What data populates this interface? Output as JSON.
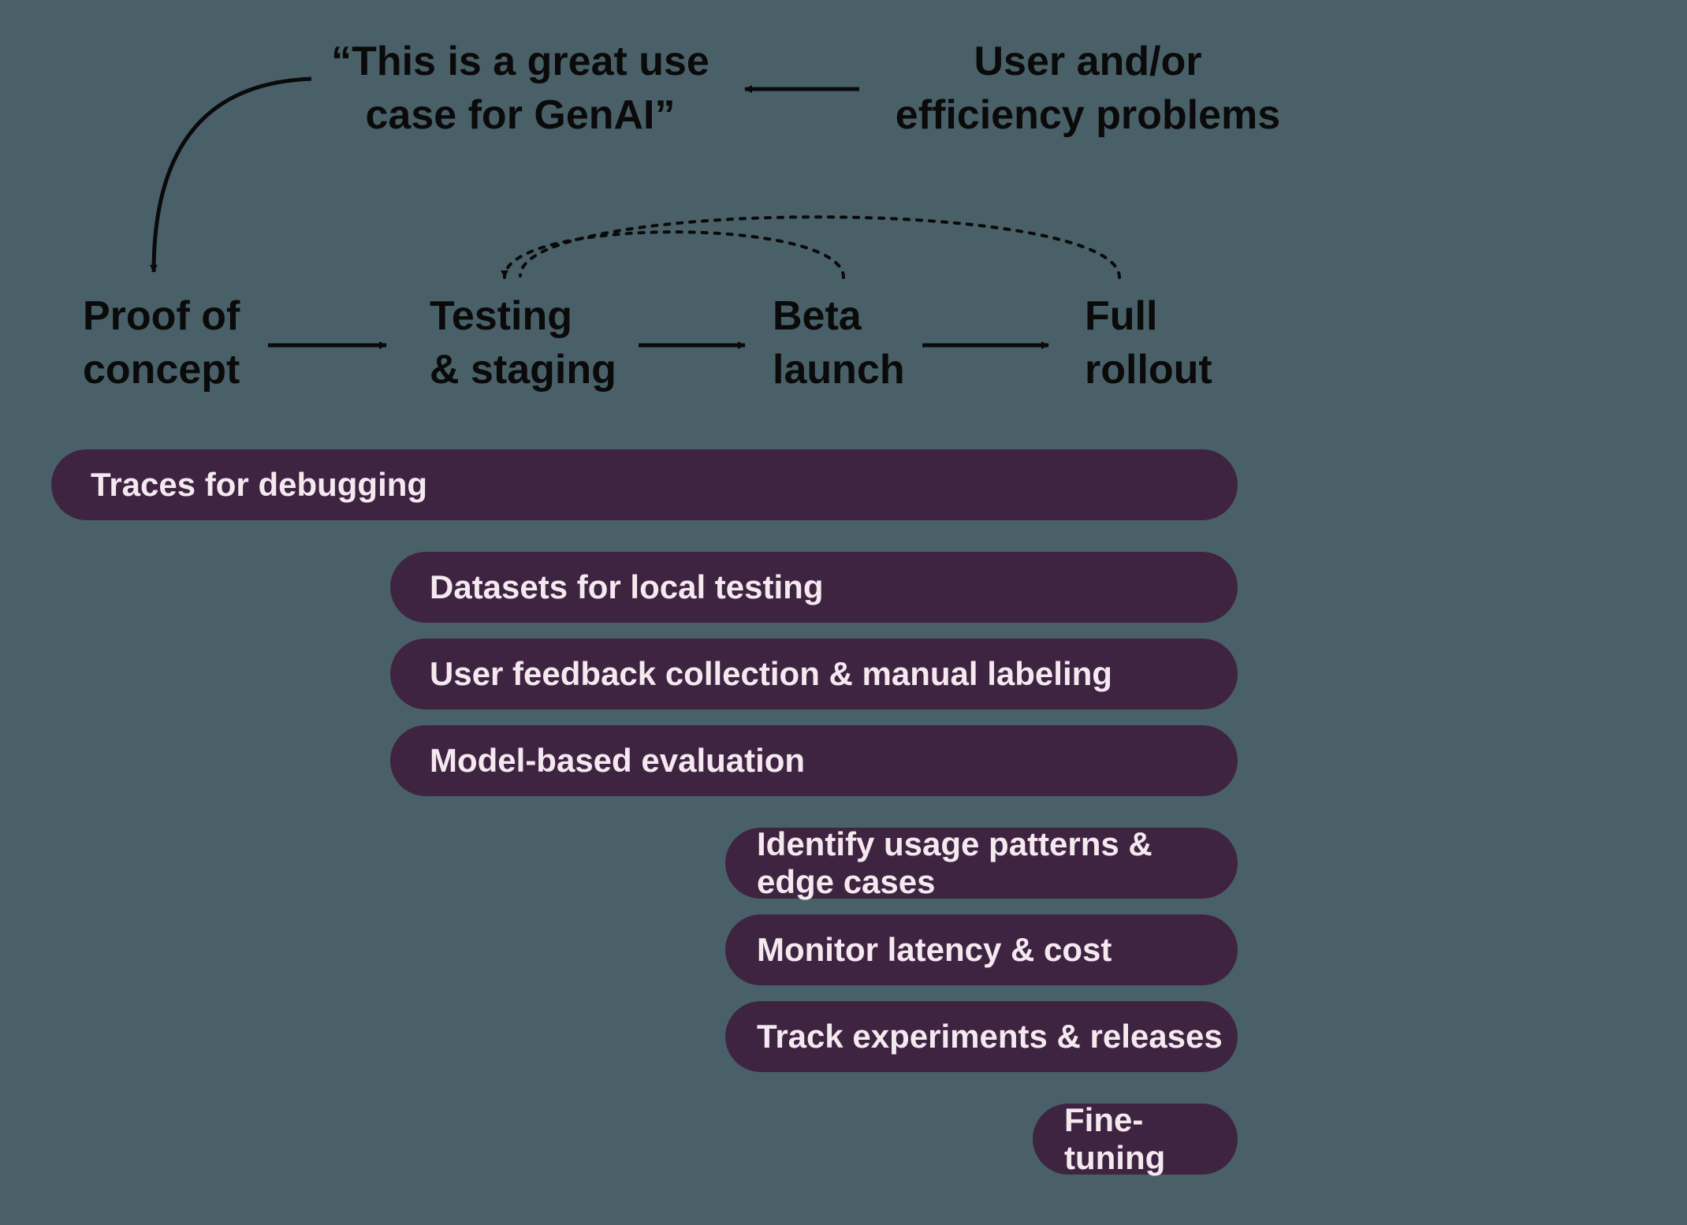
{
  "top": {
    "quote_line1": "“This is a great use",
    "quote_line2": "case for GenAI”",
    "problems_line1": "User and/or",
    "problems_line2": "efficiency problems"
  },
  "stages": {
    "poc_line1": "Proof of",
    "poc_line2": "concept",
    "testing_line1": "Testing",
    "testing_line2": "& staging",
    "beta_line1": "Beta",
    "beta_line2": "launch",
    "rollout_line1": "Full",
    "rollout_line2": "rollout"
  },
  "pills": {
    "traces": "Traces for debugging",
    "datasets": "Datasets for local testing",
    "feedback": "User feedback collection & manual labeling",
    "evaluation": "Model-based evaluation",
    "patterns": "Identify usage patterns & edge cases",
    "latency": "Monitor latency & cost",
    "experiments": "Track experiments & releases",
    "finetuning": "Fine-tuning"
  }
}
